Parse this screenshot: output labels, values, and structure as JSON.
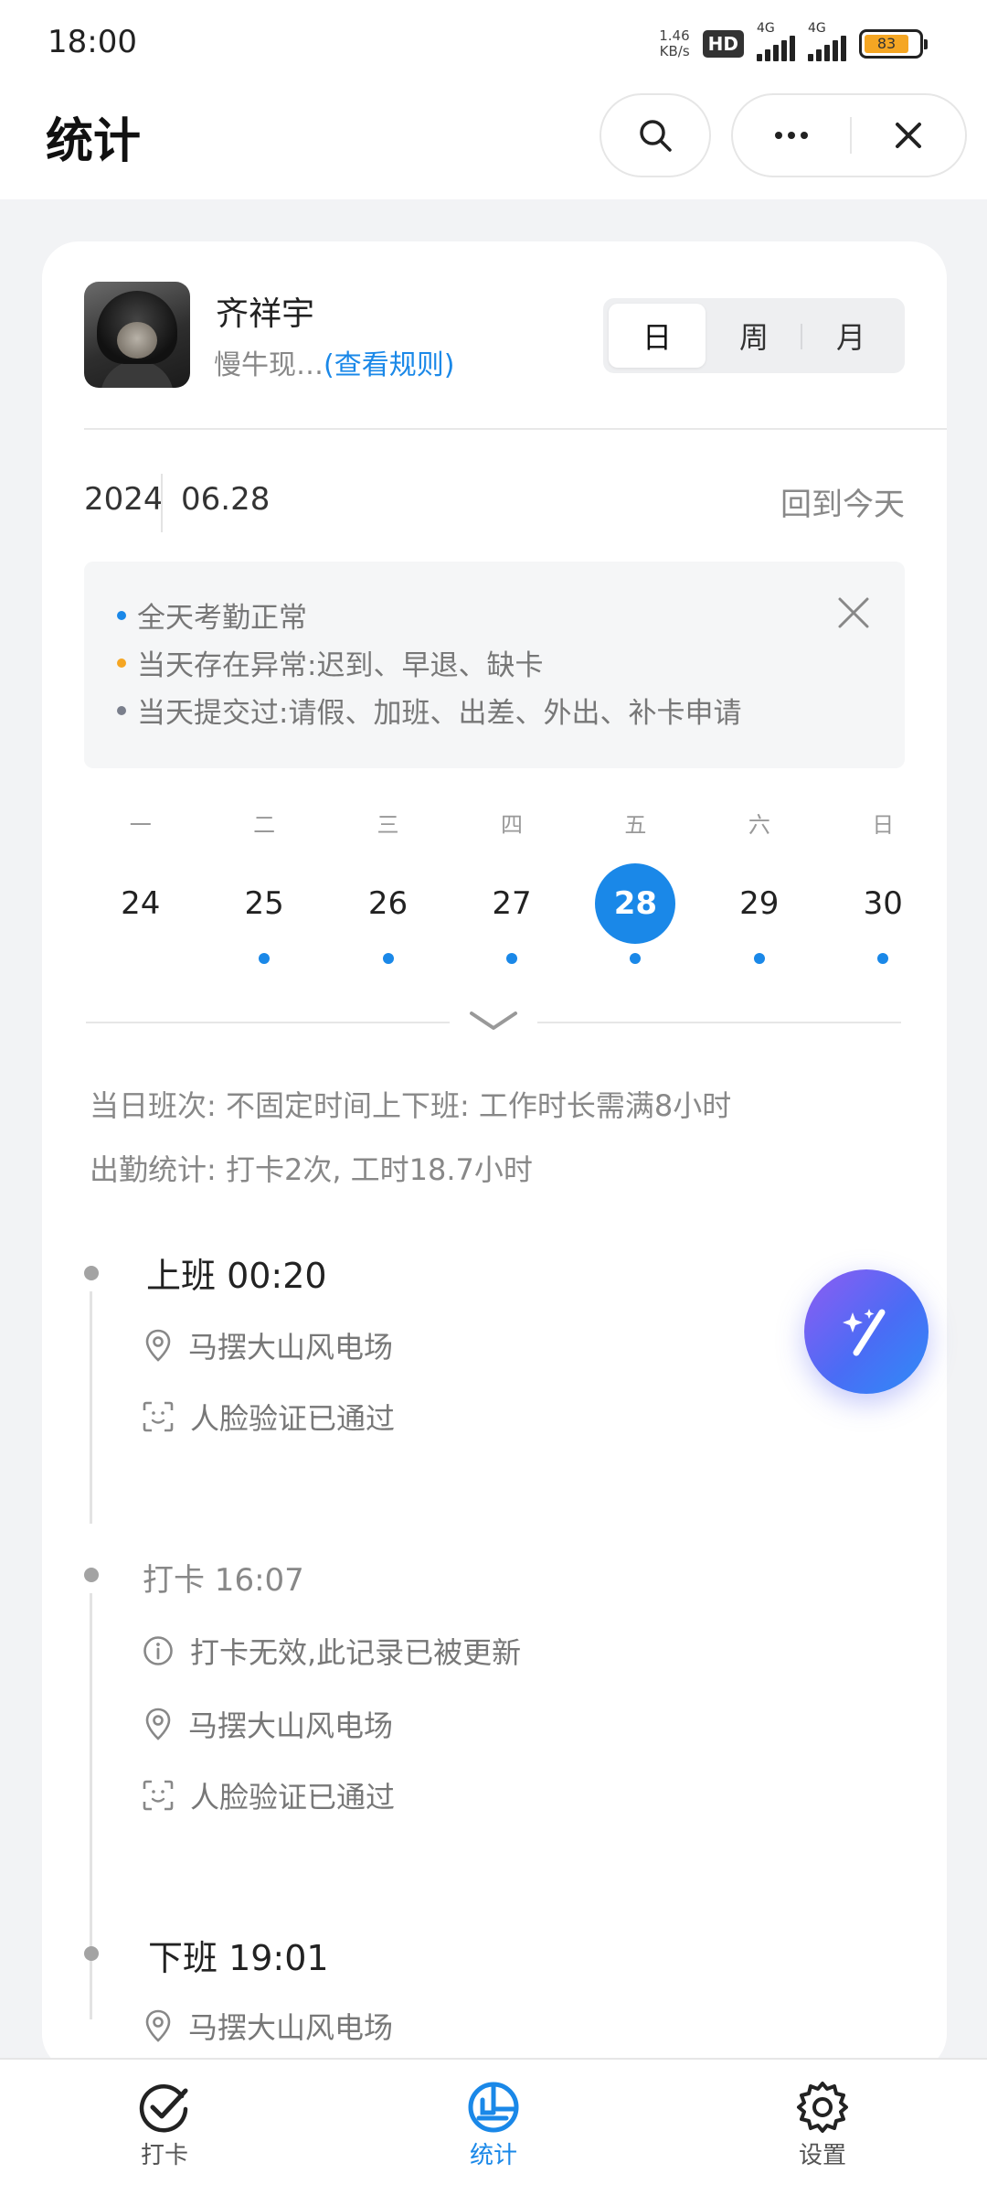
{
  "status_bar": {
    "time": "18:00",
    "net_speed_value": "1.46",
    "net_speed_unit": "KB/s",
    "hd_badge": "HD",
    "signal1_label": "4G",
    "signal2_label": "4G",
    "battery_level": "83"
  },
  "header": {
    "title": "统计"
  },
  "profile": {
    "name": "齐祥宇",
    "rule_prefix": "慢牛现…",
    "rule_link": "(查看规则)"
  },
  "period_toggle": {
    "options": [
      "日",
      "周",
      "月"
    ],
    "selected": "日"
  },
  "date_bar": {
    "year": "2024",
    "date": "06.28",
    "back_today": "回到今天"
  },
  "legend": {
    "items": [
      {
        "color": "#1a88e8",
        "text": "全天考勤正常"
      },
      {
        "color": "#f5a623",
        "text": "当天存在异常:迟到、早退、缺卡"
      },
      {
        "color": "#7a7f8c",
        "text": "当天提交过:请假、加班、出差、外出、补卡申请"
      }
    ]
  },
  "week": {
    "weekday_labels": [
      "一",
      "二",
      "三",
      "四",
      "五",
      "六",
      "日"
    ],
    "days": [
      {
        "num": "24",
        "active": false,
        "marked": false
      },
      {
        "num": "25",
        "active": false,
        "marked": true
      },
      {
        "num": "26",
        "active": false,
        "marked": true
      },
      {
        "num": "27",
        "active": false,
        "marked": true
      },
      {
        "num": "28",
        "active": true,
        "marked": true
      },
      {
        "num": "29",
        "active": false,
        "marked": true
      },
      {
        "num": "30",
        "active": false,
        "marked": true
      }
    ]
  },
  "summary": {
    "shift": "当日班次: 不固定时间上下班: 工作时长需满8小时",
    "attendance": "出勤统计: 打卡2次, 工时18.7小时"
  },
  "timeline": [
    {
      "title": "上班 00:20",
      "location": "马摆大山风电场",
      "face": "人脸验证已通过"
    },
    {
      "title": "打卡 16:07",
      "invalid_note": "打卡无效,此记录已被更新",
      "location": "马摆大山风电场",
      "face": "人脸验证已通过"
    },
    {
      "title": "下班 19:01",
      "location": "马摆大山风电场"
    }
  ],
  "bottom_nav": {
    "items": [
      {
        "label": "打卡",
        "icon": "check-icon"
      },
      {
        "label": "统计",
        "icon": "stats-icon"
      },
      {
        "label": "设置",
        "icon": "gear-icon"
      }
    ],
    "active": "统计"
  },
  "colors": {
    "accent": "#1a88e8",
    "warning": "#f5a623",
    "submitted": "#7a7f8c"
  }
}
